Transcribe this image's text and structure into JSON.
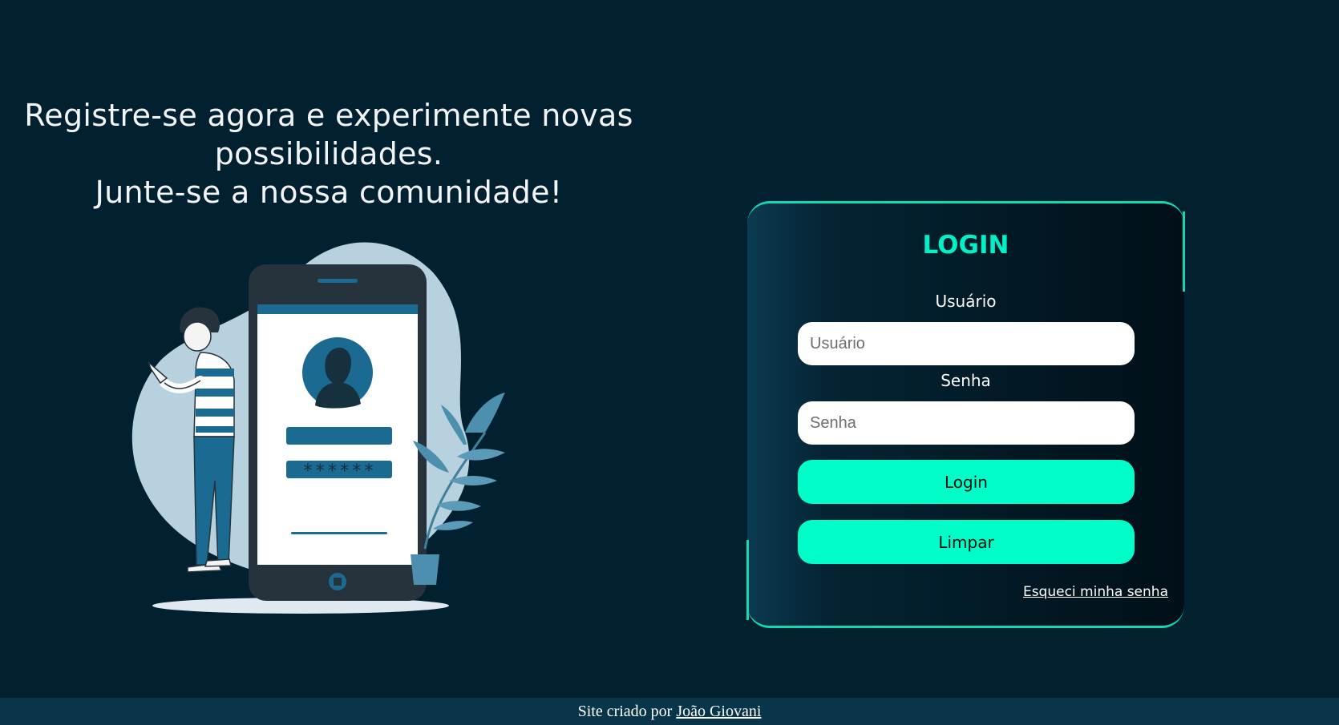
{
  "hero": {
    "line1": "Registre-se agora e experimente novas",
    "line2": "possibilidades.",
    "line3": "Junte-se a nossa comunidade!"
  },
  "illustration": {
    "password_mask": "******"
  },
  "login": {
    "title": "LOGIN",
    "username_label": "Usuário",
    "username_placeholder": "Usuário",
    "username_value": "",
    "password_label": "Senha",
    "password_placeholder": "Senha",
    "password_value": "",
    "login_button": "Login",
    "clear_button": "Limpar",
    "forgot_link": "Esqueci minha senha"
  },
  "footer": {
    "text": "Site criado por",
    "author": "João Giovani"
  },
  "colors": {
    "background": "#012030",
    "accent": "#00ffc8",
    "footer": "#083549"
  }
}
